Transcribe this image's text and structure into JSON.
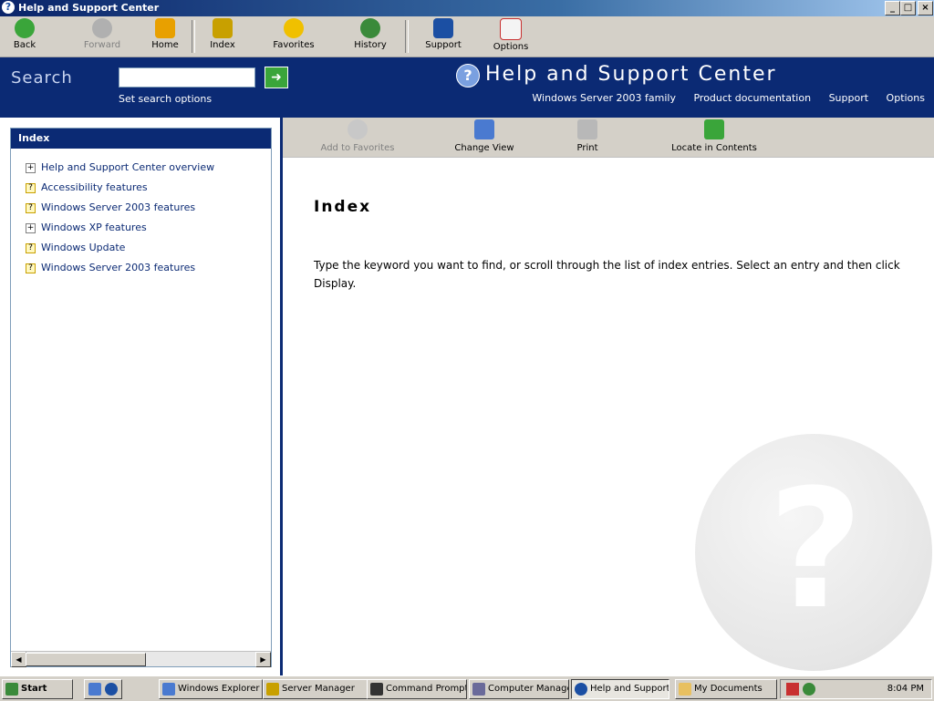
{
  "window": {
    "title": "Help and Support Center",
    "controls": {
      "minimize": "_",
      "maximize": "□",
      "close": "×"
    }
  },
  "toolbar": {
    "items": [
      {
        "label": "Back",
        "icon": "back-arrow-icon",
        "color": "#3aa53a"
      },
      {
        "label": "Forward",
        "icon": "forward-arrow-icon",
        "color": "#9a9a9a"
      },
      {
        "label": "Home",
        "icon": "home-icon",
        "color": "#e8a000"
      },
      {
        "label": "Index",
        "icon": "index-book-icon",
        "color": "#c8a000"
      },
      {
        "label": "Favorites",
        "icon": "favorites-star-icon",
        "color": "#f0c000"
      },
      {
        "label": "History",
        "icon": "history-clock-icon",
        "color": "#3a8a3a"
      },
      {
        "label": "Support",
        "icon": "support-icon",
        "color": "#1b4fa3"
      },
      {
        "label": "Options",
        "icon": "options-icon",
        "color": "#c83030"
      }
    ]
  },
  "header": {
    "search_label": "Search",
    "search_value": "",
    "search_sub": "Set search options",
    "brand": "Help and Support Center",
    "links": [
      "Windows Server 2003 family",
      "Product documentation",
      "Support",
      "Options"
    ]
  },
  "left": {
    "title": "Index",
    "items": [
      {
        "label": "Help and Support Center overview",
        "kind": "plus"
      },
      {
        "label": "Accessibility features",
        "kind": "doc"
      },
      {
        "label": "Windows Server 2003 features",
        "kind": "doc"
      },
      {
        "label": "Windows XP features",
        "kind": "plus"
      },
      {
        "label": "Windows Update",
        "kind": "doc"
      },
      {
        "label": "Windows Server 2003 features",
        "kind": "doc"
      }
    ]
  },
  "content_toolbar": {
    "items": [
      {
        "label": "Add to Favorites",
        "icon": "add-favorites-icon"
      },
      {
        "label": "Change View",
        "icon": "change-view-icon"
      },
      {
        "label": "Print",
        "icon": "print-icon"
      },
      {
        "label": "Locate in Contents",
        "icon": "locate-icon"
      }
    ]
  },
  "content": {
    "title": "Index",
    "paragraph": "Type the keyword you want to find, or scroll through the list of index entries. Select an entry and then click Display."
  },
  "taskbar": {
    "start": "Start",
    "buttons": [
      {
        "label": "Windows Explorer",
        "active": false
      },
      {
        "label": "Server Manager",
        "active": false
      },
      {
        "label": "Command Prompt",
        "active": false
      },
      {
        "label": "Computer Management",
        "active": false
      },
      {
        "label": "Help and Support",
        "active": true
      },
      {
        "label": "My Documents",
        "active": false
      }
    ],
    "tray_time": "8:04 PM"
  }
}
